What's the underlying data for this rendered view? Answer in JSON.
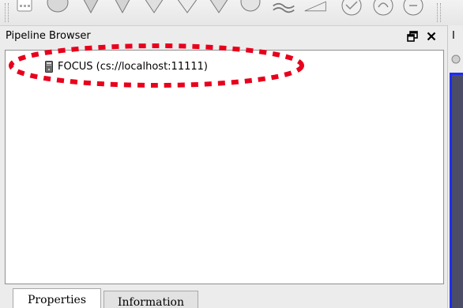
{
  "toolbar": {
    "icons": [
      "grip-icon",
      "slice-filter-icon",
      "clip-filter-icon",
      "contour-filter-icon",
      "threshold-filter-icon",
      "extract-subset-icon",
      "glyph-filter-icon",
      "stream-tracer-icon",
      "warp-filter-icon",
      "group-datasets-icon",
      "extract-level-icon"
    ]
  },
  "pipeline_browser": {
    "title": "Pipeline Browser",
    "float_button": "🗗",
    "close_button": "✕",
    "items": [
      {
        "label": "FOCUS (cs://localhost:11111)",
        "icon": "server-icon"
      }
    ]
  },
  "annotation": {
    "color": "#e8001c"
  },
  "tabs": [
    {
      "label": "Properties",
      "active": true
    },
    {
      "label": "Information",
      "active": false
    }
  ],
  "right_pane": {
    "caption": "I",
    "render_background": "#4b4c66",
    "active_border": "#1d2df0"
  }
}
